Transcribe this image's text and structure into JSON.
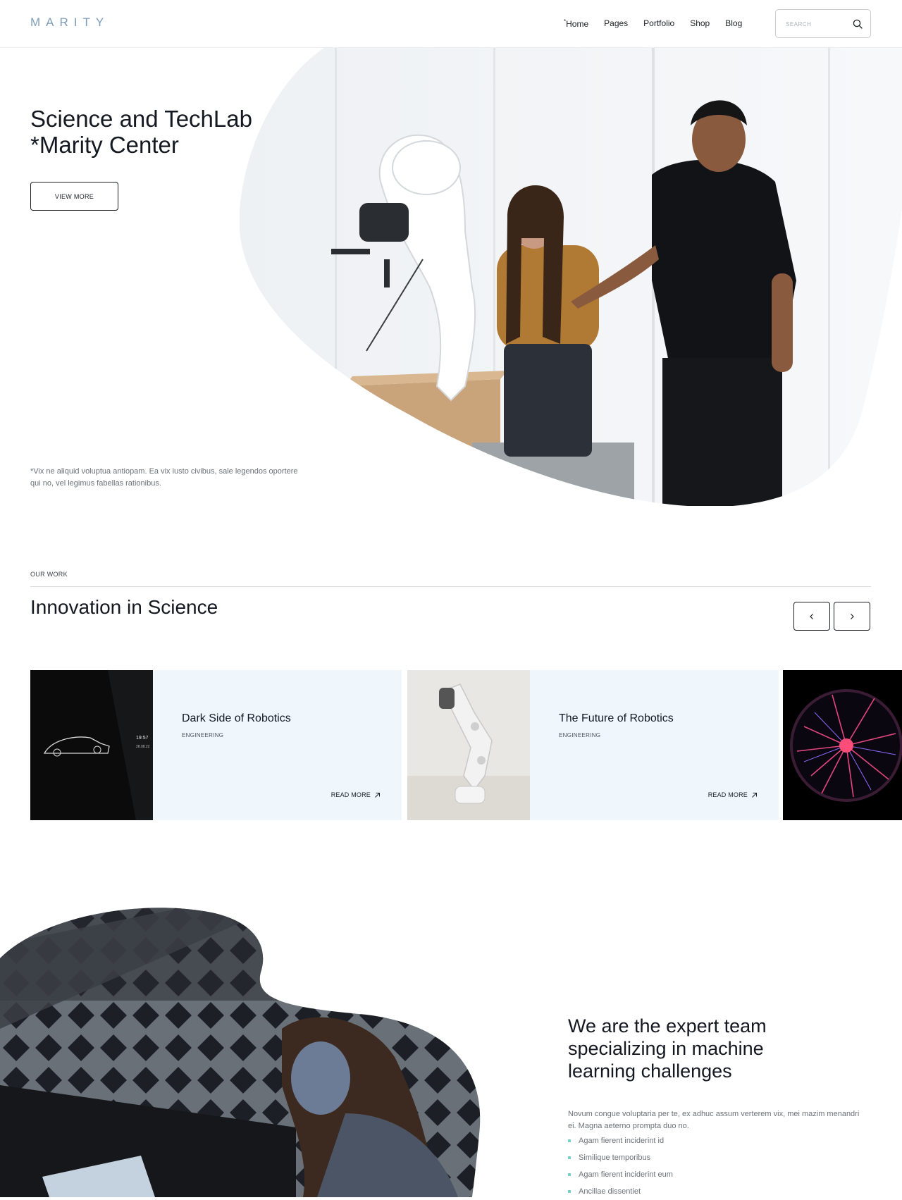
{
  "header": {
    "logo": "MARITY",
    "nav": [
      {
        "label": "Home",
        "marker": "*"
      },
      {
        "label": "Pages"
      },
      {
        "label": "Portfolio"
      },
      {
        "label": "Shop"
      },
      {
        "label": "Blog"
      }
    ],
    "search_placeholder": "SEARCH"
  },
  "hero": {
    "title_line1": "Science and TechLab",
    "title_line2": "*Marity Center",
    "button": "VIEW MORE",
    "note": "*Vix ne aliquid voluptua antiopam. Ea vix iusto civibus, sale legendos oportere qui no, vel legimus fabellas rationibus."
  },
  "work": {
    "label": "OUR WORK",
    "title": "Innovation in Science",
    "cards": [
      {
        "title": "Dark Side of Robotics",
        "category": "ENGINEERING",
        "link": "READ MORE"
      },
      {
        "title": "The Future of Robotics",
        "category": "ENGINEERING",
        "link": "READ MORE"
      }
    ],
    "car_display_time": "19:57",
    "car_display_date": "28.08.22"
  },
  "team": {
    "title_line1": "We are the expert team",
    "title_line2": "specializing in machine",
    "title_line3": "learning challenges",
    "description": "Novum congue voluptaria per te, ex adhuc assum verterem vix, mei mazim menandri ei. Magna aeterno prompta duo no.",
    "list": [
      "Agam fierent inciderint id",
      "Similique temporibus",
      "Agam fierent inciderint eum",
      "Ancillae dissentiet"
    ]
  },
  "colors": {
    "accent": "#6fd0c7",
    "logo": "#7f9cb6",
    "card_bg": "#eff6fc"
  }
}
